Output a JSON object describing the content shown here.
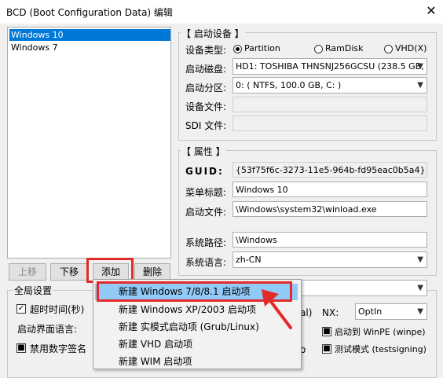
{
  "window": {
    "title": "BCD (Boot Configuration Data) 编辑",
    "close_glyph": "✕"
  },
  "entries": [
    "Windows 10",
    "Windows 7"
  ],
  "list_buttons": {
    "up": "上移",
    "down": "下移",
    "add": "添加",
    "delete": "删除"
  },
  "boot_device": {
    "group_title": "【 启动设备 】",
    "type_label": "设备类型:",
    "radio_partition": "Partition",
    "radio_ramdisk": "RamDisk",
    "radio_vhd": "VHD(X)",
    "disk_label": "启动磁盘:",
    "disk_value": "HD1: TOSHIBA THNSNJ256GCSU (238.5 GB, C:",
    "partition_label": "启动分区:",
    "partition_value": "0: ( NTFS, 100.0 GB, C: )",
    "device_file_label": "设备文件:",
    "sdi_file_label": "SDI 文件:"
  },
  "properties": {
    "group_title": "【 属性 】",
    "guid_label": "GUID:",
    "guid_value": "{53f75f6c-3273-11e5-964b-fd95eac0b5a4}",
    "menu_title_label": "菜单标题:",
    "menu_title_value": "Windows 10",
    "boot_file_label": "启动文件:",
    "boot_file_value": "\\Windows\\system32\\winload.exe",
    "sys_path_label": "系统路径:",
    "sys_path_value": "\\Windows",
    "sys_lang_label": "系统语言:",
    "sys_lang_value": "zh-CN"
  },
  "global": {
    "group_title": "全局设置",
    "timeout_label": "超时时间(秒)",
    "boot_ui_lang_label": "启动界面语言:",
    "disable_sig_label": "禁用数字签名",
    "nx_label": "NX:",
    "nx_value": "OptIn",
    "al_fragment": "al)",
    "o_fragment": "o",
    "winpe_label": "启动到 WinPE (winpe)",
    "testsign_label": "测试模式 (testsigning)"
  },
  "context_menu": [
    "新建 Windows 7/8/8.1 启动项",
    "新建 Windows XP/2003 启动项",
    "新建 实模式启动项 (Grub/Linux)",
    "新建 VHD 启动项",
    "新建 WIM 启动项"
  ],
  "colors": {
    "accent": "#0078d7",
    "highlight": "#e22b28",
    "menu_hover": "#91c9f7"
  }
}
